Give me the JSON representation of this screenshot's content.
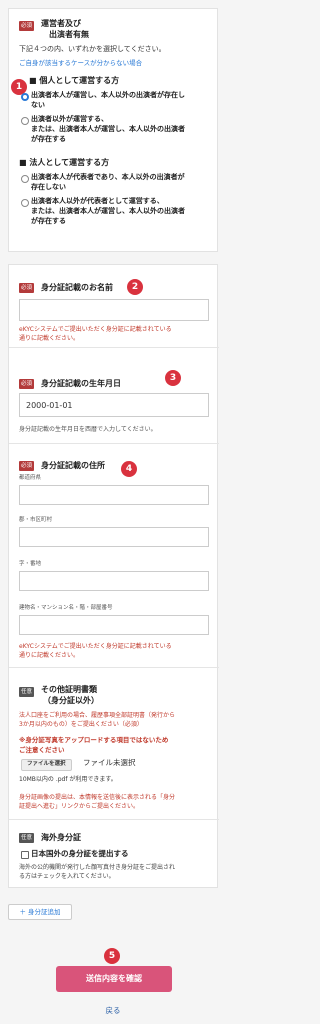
{
  "card1": {
    "badge": "必須",
    "title_line1": "運営者及び",
    "title_line2": "出演者有無",
    "desc": "下記４つの内、いずれかを選択してください。",
    "help_link": "ご自身が該当するケースが分からない場合",
    "group1_title": "個人として運営する方",
    "group2_title": "法人として運営する方",
    "options": [
      {
        "line1": "出演者本人が運営し、本人以外の出演者が存在し",
        "line2": "ない"
      },
      {
        "line1": "出演者以外が運営する、",
        "line2": "または、出演者本人が運営し、本人以外の出演者",
        "line3": "が存在する"
      },
      {
        "line1": "出演者本人が代表者であり、本人以外の出演者が",
        "line2": "存在しない"
      },
      {
        "line1": "出演者本人以外が代表者として運営する、",
        "line2": "または、出演者本人が運営し、本人以外の出演者",
        "line3": "が存在する"
      }
    ]
  },
  "numbers": [
    "1",
    "2",
    "3",
    "4",
    "5"
  ],
  "name_section": {
    "badge": "必須",
    "title": "身分証記載のお名前",
    "value": "",
    "note_line1": "eKYCシステムでご提出いただく身分証に記載されている",
    "note_line2": "通りに記載ください。"
  },
  "birth_section": {
    "badge": "必須",
    "title": "身分証記載の生年月日",
    "value": "2000-01-01",
    "note": "身分証記載の生年月日を西暦で入力してください。"
  },
  "address_section": {
    "badge": "必須",
    "title": "身分証記載の住所",
    "fields": [
      {
        "label": "都道府県",
        "value": ""
      },
      {
        "label": "郡・市区町村",
        "value": ""
      },
      {
        "label": "字・番地",
        "value": ""
      },
      {
        "label": "建物名・マンション名・階・部屋番号",
        "value": ""
      }
    ],
    "note_line1": "eKYCシステムでご提出いただく身分証に記載されている",
    "note_line2": "通りに記載ください。"
  },
  "other_docs": {
    "badge": "任意",
    "title_line1": "その他証明書類",
    "title_line2": "（身分証以外）",
    "red1_line1": "法人口座をご利用の場合、履歴事項全部証明書（発行から",
    "red1_line2": "3か月以内のもの）をご提出ください（必須）",
    "red2_line1": "※身分証写真をアップロードする項目ではないため",
    "red2_line2": "ご注意ください",
    "file_button": "ファイルを選択",
    "file_status": "ファイル未選択",
    "file_note": "10MB以内の .pdf が利用できます。",
    "red3_line1": "身分証画像の提出は、本情報を送信後に表示される「身分",
    "red3_line2": "証提出へ進む」リンクからご提出ください。"
  },
  "foreign_id": {
    "badge": "任意",
    "title": "海外身分証",
    "checkbox_label": "日本国外の身分証を提出する",
    "note_line1": "海外の公的機関が発行した顔写真付き身分証をご提出され",
    "note_line2": "る方はチェックを入れてください。"
  },
  "add_id_button": "＋ 身分証追加",
  "submit_button": "送信内容を確認",
  "back_link": "戻る",
  "colors": {
    "accent_red": "#d9323e",
    "submit_pink": "#d9547a",
    "link_blue": "#2a7ad6",
    "badge_required": "#b33a3a"
  }
}
